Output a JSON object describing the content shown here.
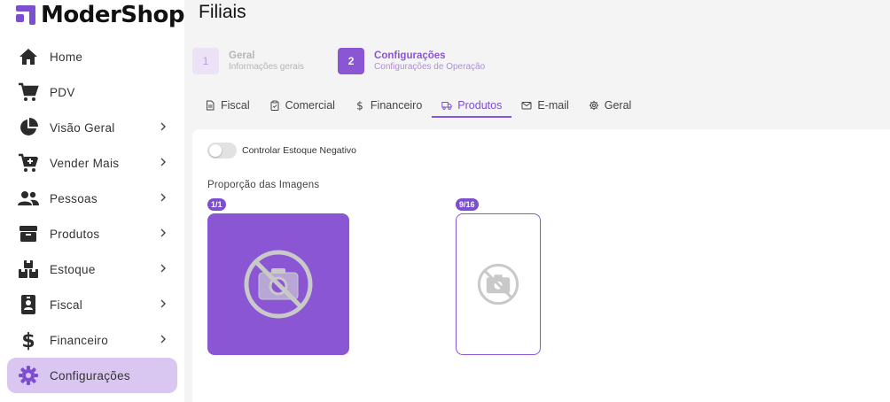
{
  "app": {
    "logo_text": "ModerShop",
    "brand_color": "#7b4fd0"
  },
  "sidebar": {
    "items": [
      {
        "label": "Home",
        "icon": "home-icon",
        "has_submenu": false
      },
      {
        "label": "PDV",
        "icon": "cart-icon",
        "has_submenu": false
      },
      {
        "label": "Visão Geral",
        "icon": "pie-chart-icon",
        "has_submenu": true
      },
      {
        "label": "Vender Mais",
        "icon": "cart-plus-icon",
        "has_submenu": true
      },
      {
        "label": "Pessoas",
        "icon": "people-icon",
        "has_submenu": true
      },
      {
        "label": "Produtos",
        "icon": "box-icon",
        "has_submenu": true
      },
      {
        "label": "Estoque",
        "icon": "stock-icon",
        "has_submenu": true
      },
      {
        "label": "Fiscal",
        "icon": "badge-icon",
        "has_submenu": true
      },
      {
        "label": "Financeiro",
        "icon": "dollar-icon",
        "has_submenu": true
      },
      {
        "label": "Configurações",
        "icon": "gear-icon",
        "has_submenu": false,
        "active": true
      }
    ]
  },
  "page": {
    "title": "Filiais"
  },
  "steps": [
    {
      "number": "1",
      "title": "Geral",
      "subtitle": "Informações gerais",
      "active": false
    },
    {
      "number": "2",
      "title": "Configurações",
      "subtitle": "Configurações de Operação",
      "active": true
    }
  ],
  "tabs": [
    {
      "label": "Fiscal",
      "icon": "document-icon"
    },
    {
      "label": "Comercial",
      "icon": "clipboard-icon"
    },
    {
      "label": "Financeiro",
      "icon": "dollar-icon"
    },
    {
      "label": "Produtos",
      "icon": "truck-icon",
      "active": true
    },
    {
      "label": "E-mail",
      "icon": "mail-icon"
    },
    {
      "label": "Geral",
      "icon": "gear-icon"
    }
  ],
  "settings": {
    "negative_stock_label": "Controlar Estoque Negativo",
    "negative_stock_enabled": false,
    "image_ratio_label": "Proporção das Imagens",
    "ratios": [
      {
        "label": "1/1",
        "selected": true
      },
      {
        "label": "9/16",
        "selected": false
      }
    ]
  }
}
